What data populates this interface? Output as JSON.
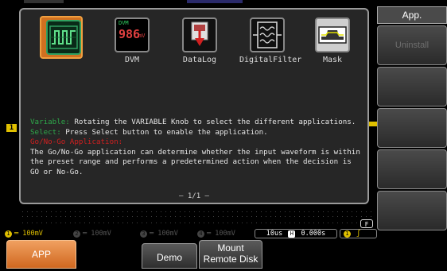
{
  "apps": [
    {
      "name": "Go/No-Go",
      "label": "",
      "icon": "go-nogo-waveform-icon",
      "selected": true
    },
    {
      "name": "DVM",
      "label": "DVM",
      "icon": "dvm-display-icon",
      "icon_text_top": "DVM",
      "icon_text_value": "986",
      "icon_text_unit": "mV"
    },
    {
      "name": "DataLog",
      "label": "DataLog",
      "icon": "datalog-icon"
    },
    {
      "name": "DigitalFilter",
      "label": "DigitalFilter",
      "icon": "digital-filter-icon"
    },
    {
      "name": "Mask",
      "label": "Mask",
      "icon": "mask-icon"
    }
  ],
  "description": {
    "variable_key": "Variable:",
    "variable_text": " Rotating the VARIABLE Knob to select the different applications.",
    "select_key": "Select:",
    "select_text": " Press Select button to enable the application.",
    "app_heading": "Go/No-Go Application:",
    "app_text": "The Go/No-Go application can determine whether the input waveform is within the preset range and performs a predetermined action when the decision is GO or No-Go."
  },
  "page_indicator": "– 1/1 –",
  "side_menu": {
    "title": "App.",
    "uninstall": "Uninstall"
  },
  "status": {
    "ch1_num": "1",
    "ch1": "100mV",
    "ch2_num": "2",
    "ch2": "100mV",
    "ch3_num": "3",
    "ch3": "100mV",
    "ch4_num": "4",
    "ch4": "100mV",
    "timebase": "10us",
    "h_badge": "H",
    "hpos": "0.000s",
    "trigger_badge": "1",
    "f_badge": "F",
    "trigger_marker": "1"
  },
  "bottom_menu": {
    "app": "APP",
    "demo": "Demo",
    "mount_line1": "Mount",
    "mount_line2": "Remote Disk"
  },
  "colors": {
    "ch1": "#e0c000",
    "accent_orange": "#d06820",
    "key_green": "#2ea84a",
    "key_red": "#d02020"
  }
}
